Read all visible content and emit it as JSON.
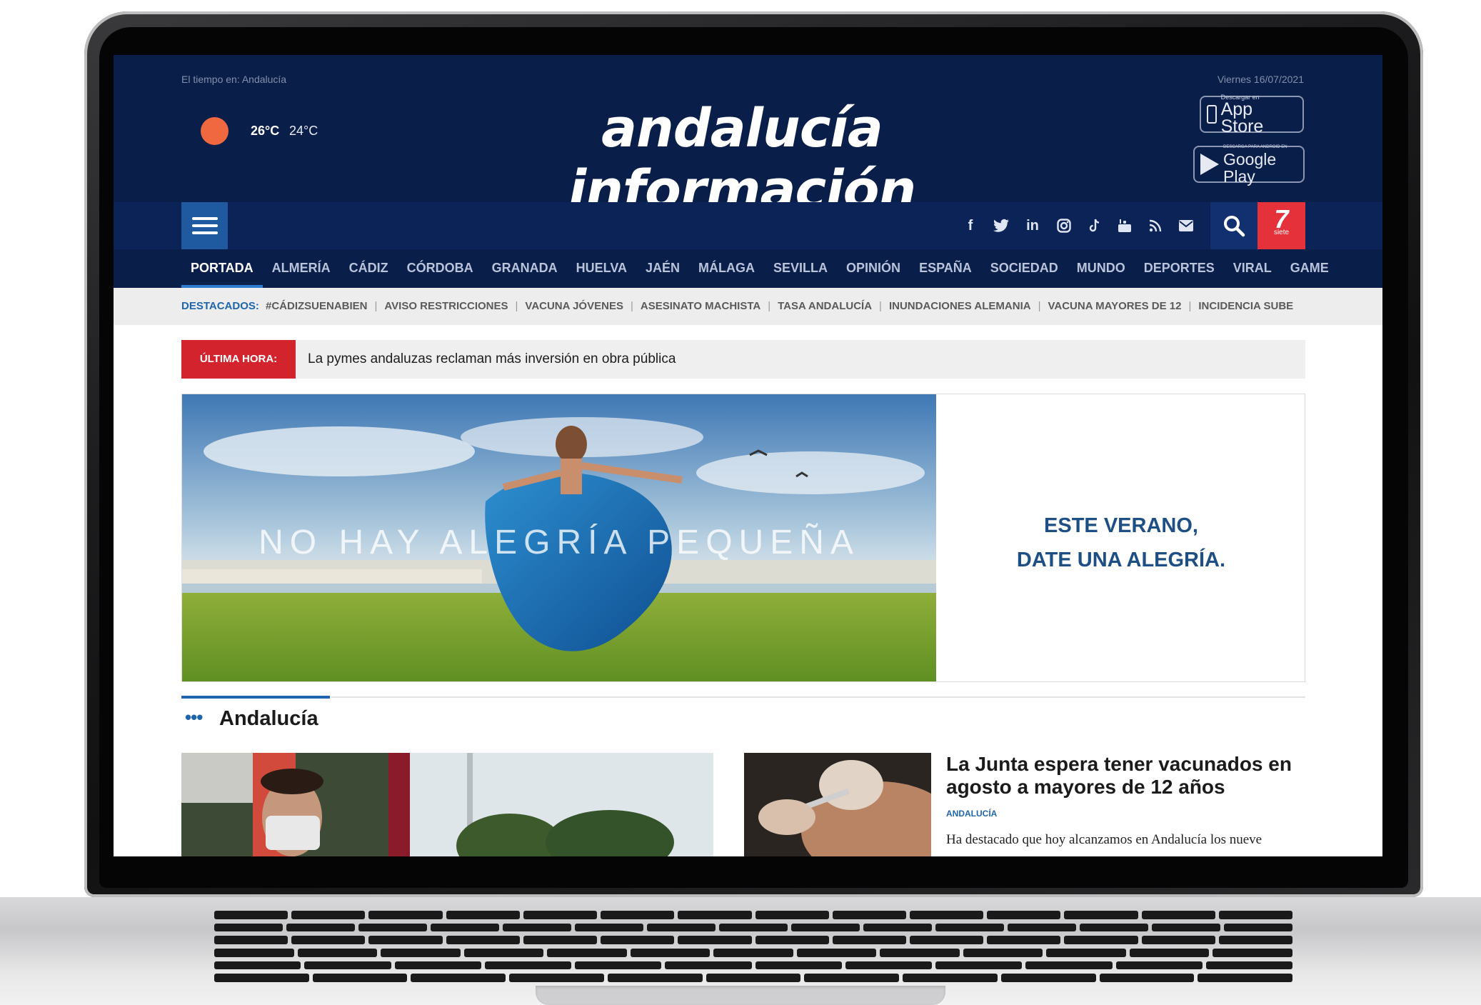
{
  "header": {
    "weather_label": "El tiempo en: Andalucía",
    "temp_max": "26°C",
    "temp_min": "24°C",
    "logo": "andalucía información",
    "date": "Viernes 16/07/2021",
    "appstore": {
      "small": "Descargar en",
      "big": "App Store"
    },
    "googleplay": {
      "small": "DESCARGA PARA ANDROID EN",
      "big": "Google Play"
    }
  },
  "toolbar": {
    "social_icons": [
      "facebook-icon",
      "twitter-icon",
      "linkedin-icon",
      "instagram-icon",
      "tiktok-icon",
      "youtube-icon",
      "rss-icon",
      "mail-icon"
    ],
    "siete_label": "siete"
  },
  "nav": {
    "items": [
      "PORTADA",
      "ALMERÍA",
      "CÁDIZ",
      "CÓRDOBA",
      "GRANADA",
      "HUELVA",
      "JAÉN",
      "MÁLAGA",
      "SEVILLA",
      "OPINIÓN",
      "ESPAÑA",
      "SOCIEDAD",
      "MUNDO",
      "DEPORTES",
      "VIRAL",
      "GAME"
    ],
    "active": "PORTADA"
  },
  "destacados": {
    "label": "DESTACADOS:",
    "items": [
      "#CÁDIZSUENABIEN",
      "AVISO RESTRICCIONES",
      "VACUNA JÓVENES",
      "ASESINATO MACHISTA",
      "TASA ANDALUCÍA",
      "INUNDACIONES ALEMANIA",
      "VACUNA MAYORES DE 12",
      "INCIDENCIA SUBE"
    ]
  },
  "breaking": {
    "label": "ÚLTIMA HORA:",
    "text": "La pymes andaluzas reclaman más inversión en obra pública"
  },
  "ad": {
    "slogan_left": "NO HAY ALEGRÍA PEQUEÑA",
    "slogan_right_line1": "ESTE VERANO,",
    "slogan_right_line2": "DATE UNA ALEGRÍA."
  },
  "section": {
    "title": "Andalucía",
    "dots": "•••"
  },
  "article": {
    "title": "La Junta espera tener vacunados en agosto a mayores de 12 años",
    "category": "ANDALUCÍA",
    "excerpt": "Ha destacado que hoy alcanzamos en Andalucía los nueve"
  },
  "colors": {
    "header_bg": "#0a1e4a",
    "accent_blue": "#1f65ad",
    "breaking_red": "#d3242d",
    "siete_red": "#e4313a"
  }
}
